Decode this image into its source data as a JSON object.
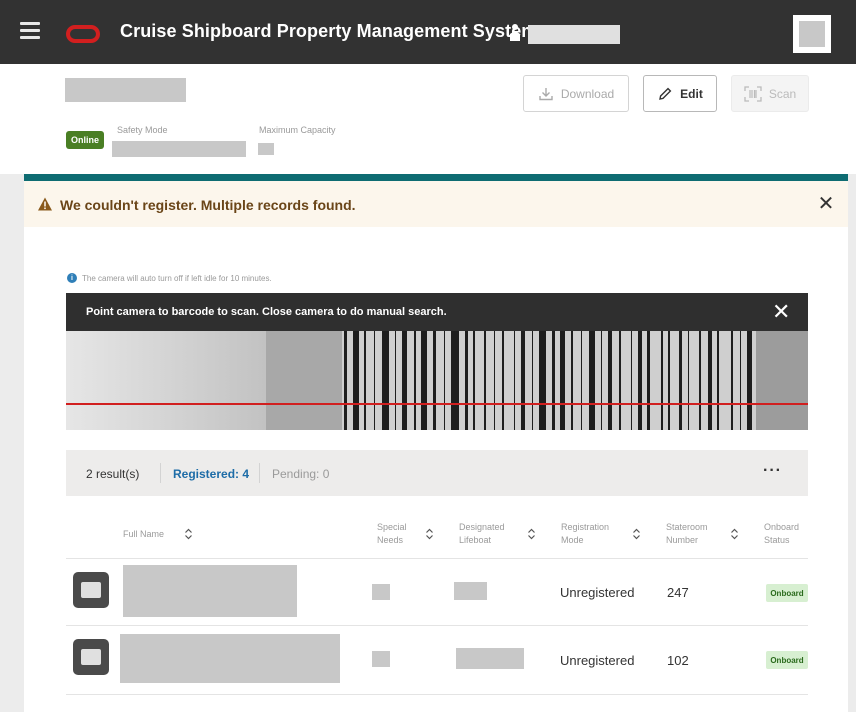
{
  "header": {
    "app_title": "Cruise Shipboard Property Management System",
    "icons": [
      "menu-icon",
      "oracle-logo",
      "user-icon",
      "avatar"
    ]
  },
  "toolbar": {
    "download_label": "Download",
    "edit_label": "Edit",
    "scan_label": "Scan"
  },
  "status": {
    "badge": "Online",
    "badge_color": "#4a7f24",
    "safety_mode_label": "Safety Mode",
    "max_capacity_label": "Maximum Capacity"
  },
  "alert": {
    "message": "We couldn't register. Multiple records found.",
    "accent_color": "#0e6c72"
  },
  "camera": {
    "info": "The camera will auto turn off if left idle for 10 minutes.",
    "instruction": "Point camera to barcode to scan. Close camera to do manual search."
  },
  "results": {
    "count": "2 result(s)",
    "registered": "Registered: 4",
    "pending": "Pending: 0",
    "more": "···"
  },
  "table": {
    "columns": [
      {
        "line1": "Full Name",
        "line2": ""
      },
      {
        "line1": "Special",
        "line2": "Needs"
      },
      {
        "line1": "Designated",
        "line2": "Lifeboat"
      },
      {
        "line1": "Registration",
        "line2": "Mode"
      },
      {
        "line1": "Stateroom",
        "line2": "Number"
      },
      {
        "line1": "Onboard",
        "line2": "Status"
      }
    ],
    "rows": [
      {
        "registration_mode": "Unregistered",
        "stateroom": "247",
        "status": "Onboard"
      },
      {
        "registration_mode": "Unregistered",
        "stateroom": "102",
        "status": "Onboard"
      }
    ]
  }
}
